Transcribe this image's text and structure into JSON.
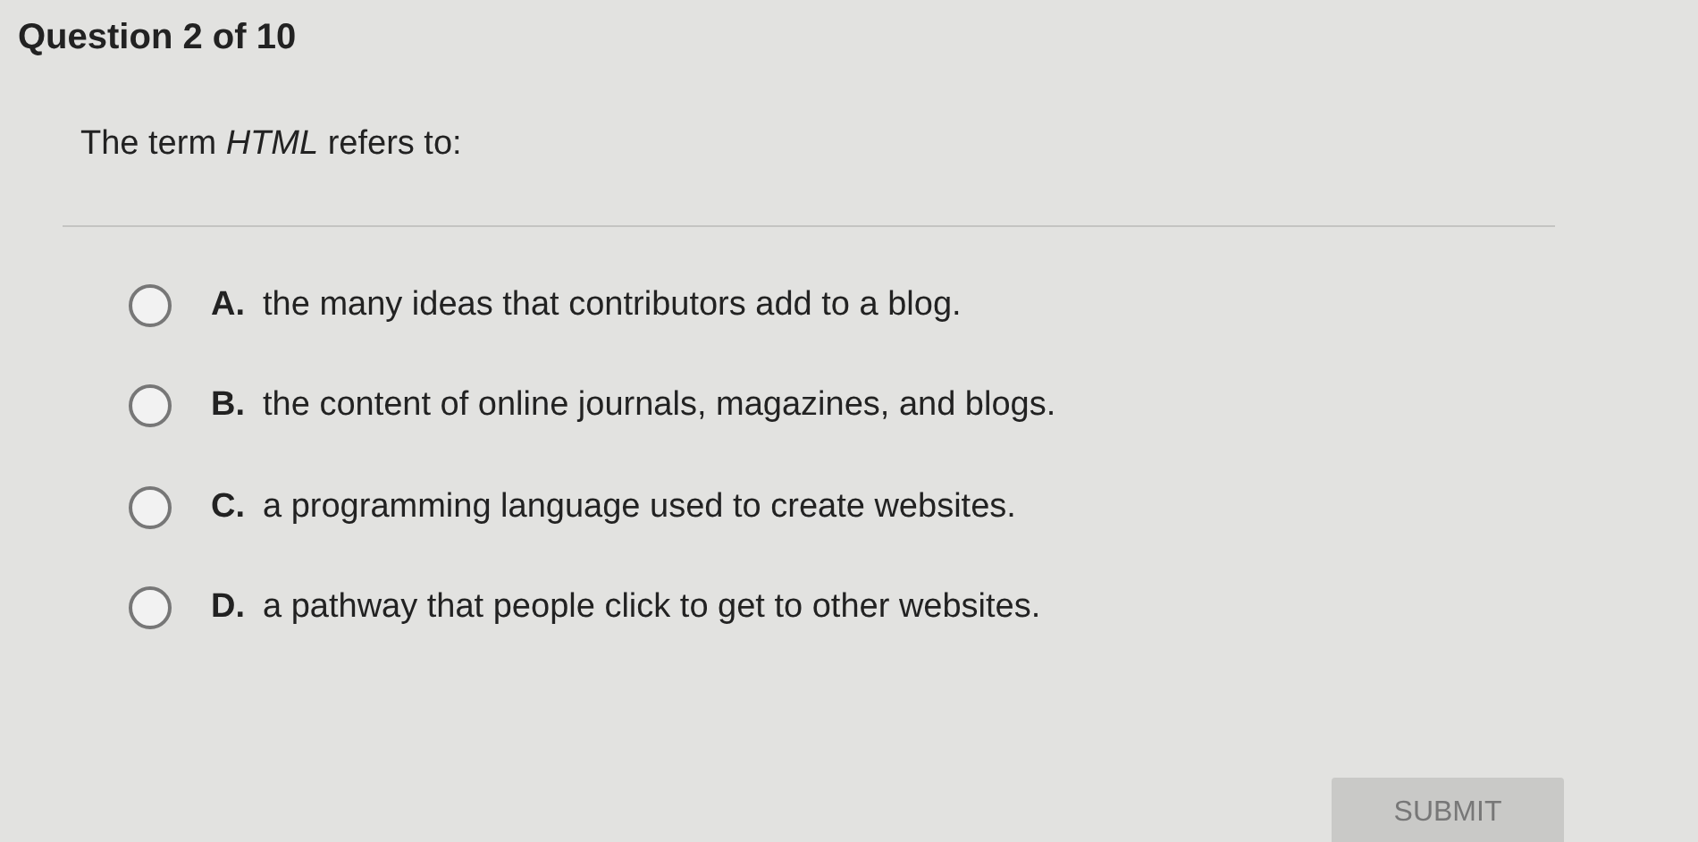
{
  "header": {
    "title": "Question 2 of 10"
  },
  "question": {
    "prompt": "The term *HTML* refers to:"
  },
  "options": [
    {
      "letter": "A.",
      "text": "the many ideas that contributors add to a blog.",
      "selected": false
    },
    {
      "letter": "B.",
      "text": "the content of online journals, magazines, and blogs.",
      "selected": false
    },
    {
      "letter": "C.",
      "text": "a programming language used to create websites.",
      "selected": false
    },
    {
      "letter": "D.",
      "text": "a pathway that people click to get to other websites.",
      "selected": false
    }
  ],
  "submit": {
    "label": "SUBMIT",
    "disabled": true
  }
}
